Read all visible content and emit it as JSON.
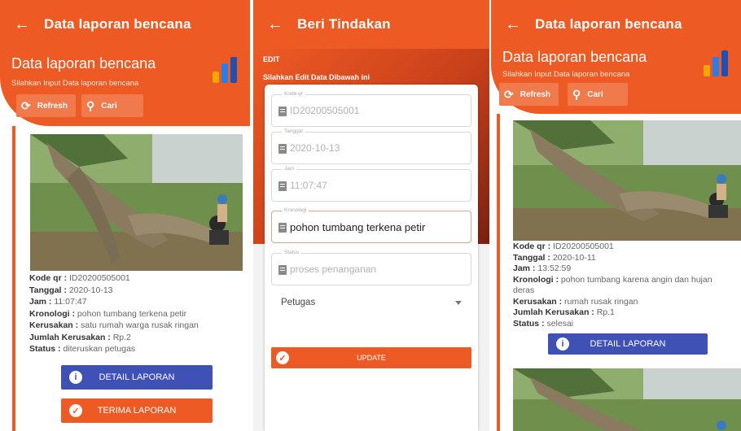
{
  "screens": [
    {
      "appbar_title": "Data laporan bencana",
      "header_title": "Data laporan bencana",
      "header_subtitle": "Silahkan Input Data laporan bencana",
      "refresh_label": "Refresh",
      "search_label": "Cari",
      "card": {
        "kode_label": "Kode qr :",
        "kode_value": "ID20200505001",
        "tanggal_label": "Tanggal :",
        "tanggal_value": "2020-10-13",
        "jam_label": "Jam :",
        "jam_value": "11:07:47",
        "kronologi_label": "Kronologi :",
        "kronologi_value": "pohon tumbang terkena petir",
        "kerusakan_label": "Kerusakan :",
        "kerusakan_value": "satu rumah warga rusak ringan",
        "jumlah_label": "Jumlah Kerusakan :",
        "jumlah_value": "Rp.2",
        "status_label": "Status :",
        "status_value": "diteruskan petugas",
        "detail_button": "DETAIL LAPORAN",
        "terima_button": "TERIMA LAPORAN"
      }
    },
    {
      "appbar_title": "Beri Tindakan",
      "edit_title": "EDIT",
      "edit_subtitle": "Silahkan Edit Data Dibawah ini",
      "fields": [
        {
          "label": "Kode qr",
          "value": "ID20200505001"
        },
        {
          "label": "Tanggal",
          "value": "2020-10-13"
        },
        {
          "label": "Jam",
          "value": "11:07:47"
        },
        {
          "label": "Kronologi",
          "value": "pohon tumbang terkena petir"
        },
        {
          "label": "Status",
          "value": "proses penanganan"
        }
      ],
      "petugas_label": "Petugas",
      "update_button": "UPDATE"
    },
    {
      "appbar_title": "Data laporan bencana",
      "header_title": "Data laporan bencana",
      "header_subtitle": "Silahkan Input Data laporan bencana",
      "refresh_label": "Refresh",
      "search_label": "Cari",
      "card": {
        "kode_label": "Kode qr :",
        "kode_value": "ID20200505001",
        "tanggal_label": "Tanggal :",
        "tanggal_value": "2020-10-11",
        "jam_label": "Jam :",
        "jam_value": "13:52:59",
        "kronologi_label": "Kronologi :",
        "kronologi_value": "pohon tumbang karena angin dan hujan deras",
        "kerusakan_label": "Kerusakan :",
        "kerusakan_value": "rumah rusak ringan",
        "jumlah_label": "Jumlah Kerusakan :",
        "jumlah_value": "Rp.1",
        "status_label": "Status :",
        "status_value": "selesai",
        "detail_button": "DETAIL LAPORAN"
      }
    }
  ],
  "icons": {
    "back": "arrow-left-icon",
    "refresh": "refresh-icon",
    "search": "search-icon",
    "chart": "bar-chart-icon",
    "info": "info-icon",
    "check": "check-circle-icon",
    "field": "clipboard-icon",
    "dropdown": "chevron-down-icon"
  },
  "colors": {
    "primary": "#ee5a24",
    "button_blue": "#3f51b5",
    "tool_button": "#f07a4c"
  }
}
